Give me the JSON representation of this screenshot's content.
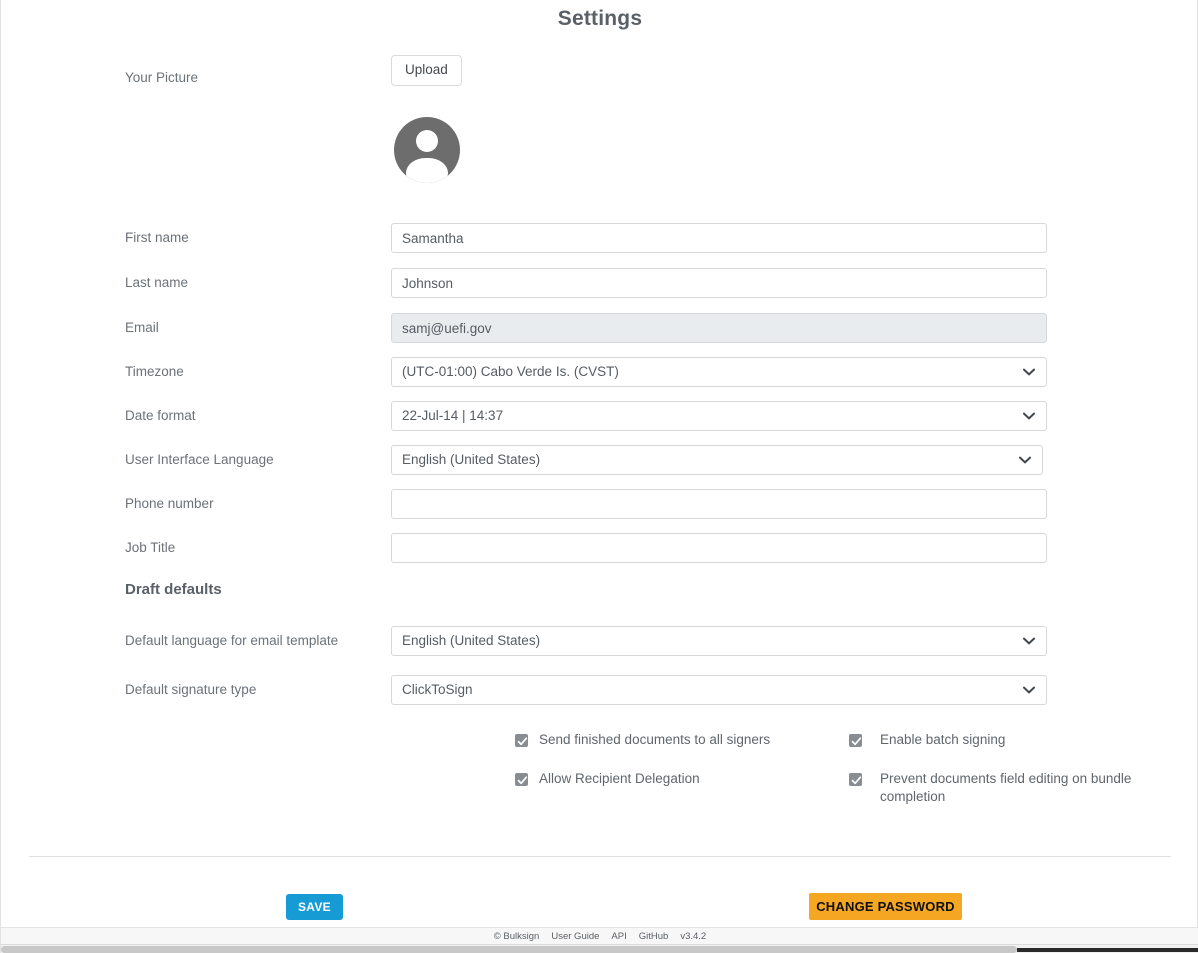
{
  "page": {
    "title": "Settings"
  },
  "picture": {
    "label": "Your Picture",
    "upload_label": "Upload",
    "avatar_icon": "user-avatar-icon"
  },
  "fields": [
    {
      "key": "first_name",
      "label": "First name",
      "type": "text",
      "value": "Samantha",
      "placeholder": "",
      "readonly": false
    },
    {
      "key": "last_name",
      "label": "Last name",
      "type": "text",
      "value": "Johnson",
      "placeholder": "",
      "readonly": false
    },
    {
      "key": "email",
      "label": "Email",
      "type": "text",
      "value": "samj@uefi.gov",
      "placeholder": "",
      "readonly": true
    },
    {
      "key": "timezone",
      "label": "Timezone",
      "type": "select",
      "value": "(UTC-01:00) Cabo Verde Is. (CVST)"
    },
    {
      "key": "date_format",
      "label": "Date format",
      "type": "select",
      "value": "22-Jul-14 | 14:37"
    },
    {
      "key": "ui_language",
      "label": "User Interface Language",
      "type": "select",
      "value": "English (United States)"
    },
    {
      "key": "phone_number",
      "label": "Phone number",
      "type": "text",
      "value": "",
      "placeholder": "",
      "readonly": false
    },
    {
      "key": "job_title",
      "label": "Job Title",
      "type": "text",
      "value": "",
      "placeholder": "",
      "readonly": false
    }
  ],
  "draft_defaults": {
    "heading": "Draft defaults",
    "fields": [
      {
        "key": "default_email_language",
        "label": "Default language for email template",
        "type": "select",
        "value": "English (United States)"
      },
      {
        "key": "default_signature_type",
        "label": "Default signature type",
        "type": "select",
        "value": "ClickToSign"
      }
    ],
    "checkboxes": [
      {
        "key": "send_finished_documents",
        "label": "Send finished documents to all signers",
        "checked": true
      },
      {
        "key": "enable_batch_signing",
        "label": "Enable batch signing",
        "checked": true
      },
      {
        "key": "allow_recipient_delegation",
        "label": "Allow Recipient Delegation",
        "checked": true
      },
      {
        "key": "prevent_field_editing",
        "label": "Prevent documents field editing on bundle completion",
        "checked": true
      }
    ]
  },
  "actions": {
    "save_label": "SAVE",
    "change_password_label": "CHANGE PASSWORD",
    "save_color": "#169bd5",
    "change_password_color": "#f5a623"
  },
  "footer": {
    "copyright": "© Bulksign",
    "links": [
      "User Guide",
      "API",
      "GitHub"
    ],
    "version": "v3.4.2"
  },
  "icons": {
    "chevron_down": "chevron-down-icon",
    "checkmark": "checkmark-icon"
  }
}
